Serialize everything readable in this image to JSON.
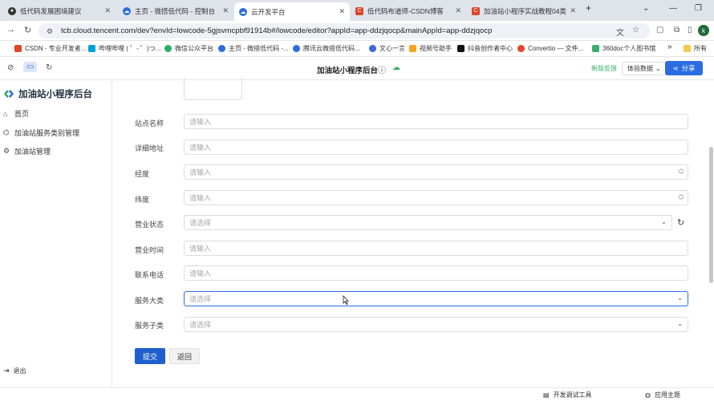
{
  "browser": {
    "tabs": [
      {
        "label": "低代码发展困境建议",
        "icon_color": "#333333"
      },
      {
        "label": "主页 - 微搭低代码 - 控制台",
        "icon_color": "#2b6de0"
      },
      {
        "label": "云开发平台",
        "icon_color": "#2b6de0"
      },
      {
        "label": "低代码布道师-CSDN博客",
        "icon_color": "#e0462a"
      },
      {
        "label": "加油站小程序实战教程04类目...",
        "icon_color": "#e0462a"
      }
    ],
    "new_tab": "+",
    "window_controls": [
      "⌄",
      "—",
      "❐"
    ],
    "url": "tcb.cloud.tencent.com/dev?envId=lowcode-5gjsvmcpbf91914b#/lowcode/editor?appId=app-ddzjqocp&mainAppId=app-ddzjqocp",
    "avatar_letter": "k",
    "bookmarks": [
      {
        "label": "CSDN - 专业开发者...",
        "color": "#e0462a"
      },
      {
        "label": "哔哩哔哩 ( ゜- ゜)つ...",
        "color": "#00a1d6"
      },
      {
        "label": "微信公众平台",
        "color": "#2aae67"
      },
      {
        "label": "主页 - 微搭低代码 -...",
        "color": "#2b6de0"
      },
      {
        "label": "腾讯云微搭低代码...",
        "color": "#2b6de0"
      },
      {
        "label": "文心一言",
        "color": "#3a66e0"
      },
      {
        "label": "视频号助手",
        "color": "#f4a623"
      },
      {
        "label": "抖音创作者中心",
        "color": "#111111"
      },
      {
        "label": "Convertio — 文件...",
        "color": "#e0462a"
      },
      {
        "label": "360doc个人图书馆",
        "color": "#3aaf6b"
      }
    ],
    "bookmarks_more": "»",
    "bookmarks_all": "所有"
  },
  "toolbar": {
    "title": "加油站小程序后台",
    "new_version": "新版反馈",
    "experience_data": "体验数据",
    "share": "分享"
  },
  "sidebar": {
    "title": "加油站小程序后台",
    "items": [
      {
        "label": "首页",
        "icon": "home-icon"
      },
      {
        "label": "加油站服务类别管理",
        "icon": "tag-icon"
      },
      {
        "label": "加油站管理",
        "icon": "settings-icon"
      }
    ],
    "logout": "退出"
  },
  "form": {
    "fields": [
      {
        "label": "站点名称",
        "placeholder": "请输入",
        "type": "text"
      },
      {
        "label": "详细地址",
        "placeholder": "请输入",
        "type": "text"
      },
      {
        "label": "经度",
        "placeholder": "请输入",
        "type": "number"
      },
      {
        "label": "纬度",
        "placeholder": "请输入",
        "type": "number"
      },
      {
        "label": "营业状态",
        "placeholder": "请选择",
        "type": "select"
      },
      {
        "label": "营业时间",
        "placeholder": "请输入",
        "type": "text"
      },
      {
        "label": "联系电话",
        "placeholder": "请输入",
        "type": "text"
      },
      {
        "label": "服务大类",
        "placeholder": "请选择",
        "type": "select"
      },
      {
        "label": "服务子类",
        "placeholder": "请选择",
        "type": "select"
      }
    ],
    "submit": "提交",
    "back": "返回"
  },
  "bottom": {
    "devtools": "开发调试工具",
    "theme": "应用主题"
  }
}
